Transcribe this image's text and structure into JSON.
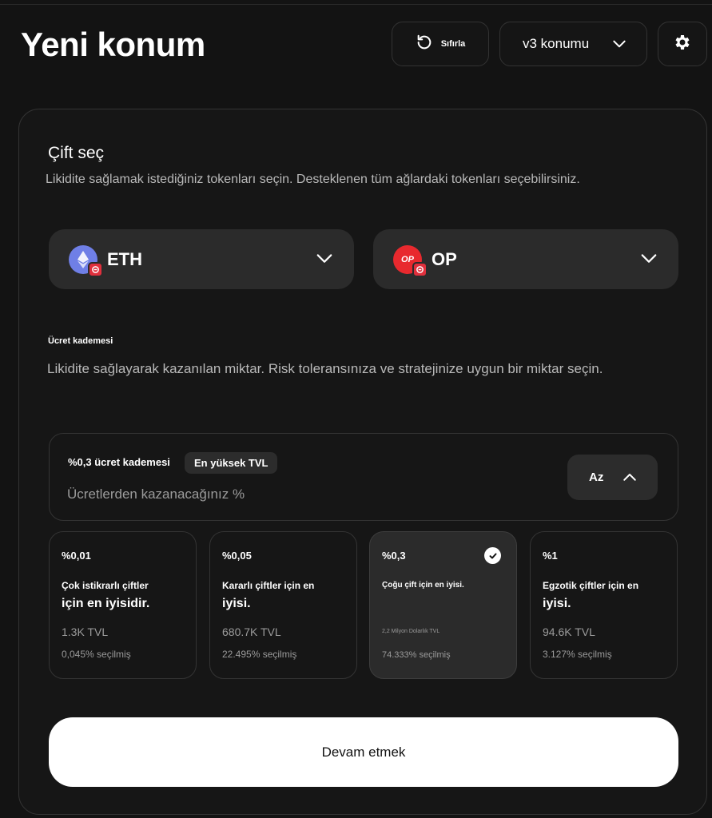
{
  "header": {
    "title": "Yeni konum",
    "reset_label": "Sıfırla",
    "version_label": "v3 konumu"
  },
  "pair": {
    "title": "Çift seç",
    "description": "Likidite sağlamak istediğiniz tokenları seçin. Desteklenen tüm ağlardaki tokenları seçebilirsiniz.",
    "token_a": {
      "symbol": "ETH",
      "icon": "ethereum-icon",
      "color": "#6f7fe6"
    },
    "token_b": {
      "symbol": "OP",
      "icon_text": "OP",
      "icon": "optimism-icon",
      "color": "#e8292e"
    }
  },
  "fee": {
    "title": "Ücret kademesi",
    "description": "Likidite sağlayarak kazanılan miktar. Risk toleransınıza ve stratejinize uygun bir miktar seçin.",
    "selected_label": "%0,3 ücret kademesi",
    "badge": "En yüksek TVL",
    "earn_text": "Ücretlerden kazanacağınız %",
    "toggle_label": "Az",
    "tiers": [
      {
        "pct": "%0,01",
        "desc1": "Çok istikrarlı çiftler",
        "desc2": "için en iyisidir.",
        "tvl": "1.3K TVL",
        "selected": "0,045% seçilmiş"
      },
      {
        "pct": "%0,05",
        "desc1": "Kararlı çiftler için en",
        "desc2": "iyisi.",
        "tvl": "680.7K TVL",
        "selected": "22.495% seçilmiş"
      },
      {
        "pct": "%0,3",
        "desc1": "Çoğu çift için en iyisi.",
        "desc2": "",
        "tvl": "2,2 Milyon Dolarlık TVL",
        "selected": "74.333% seçilmiş",
        "is_selected": true
      },
      {
        "pct": "%1",
        "desc1": "Egzotik çiftler için en",
        "desc2": "iyisi.",
        "tvl": "94.6K TVL",
        "selected": "3.127% seçilmiş"
      }
    ]
  },
  "continue_label": "Devam etmek",
  "colors": {
    "background": "#131313",
    "card": "#161616",
    "surface": "#2b2b2b",
    "border": "#343434",
    "text_secondary": "#9b9b9b"
  }
}
